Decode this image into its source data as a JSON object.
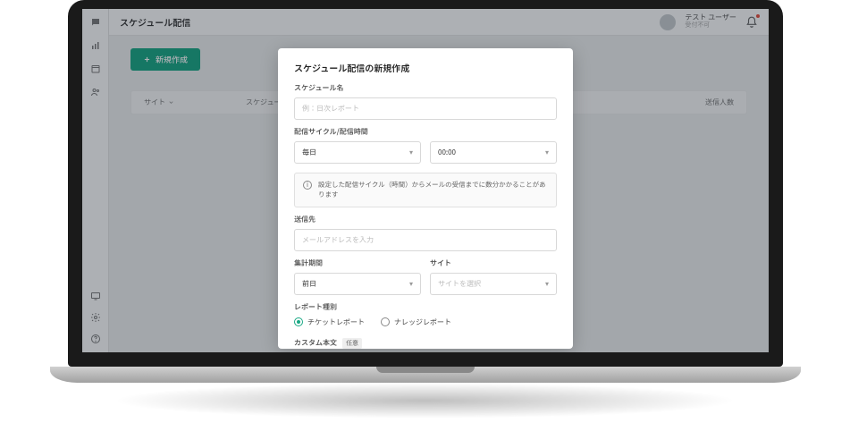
{
  "header": {
    "page_title": "スケジュール配信",
    "user_name": "テスト ユーザー",
    "user_status": "受付不可"
  },
  "content": {
    "new_button": "新規作成",
    "table": {
      "col_site": "サイト",
      "col_schedule": "スケジュー…",
      "col_recipients": "送信人数"
    }
  },
  "modal": {
    "title": "スケジュール配信の新規作成",
    "schedule_name_label": "スケジュール名",
    "schedule_name_placeholder": "例：日次レポート",
    "cycle_label": "配信サイクル/配信時間",
    "cycle_value": "毎日",
    "time_value": "00:00",
    "info_text": "設定した配信サイクル（時間）からメールの受信までに数分かかることがあります",
    "recipients_label": "送信先",
    "recipients_placeholder": "メールアドレスを入力",
    "period_label": "集計期間",
    "period_value": "前日",
    "site_label": "サイト",
    "site_placeholder": "サイトを選択",
    "report_type_label": "レポート種別",
    "report_ticket": "チケットレポート",
    "report_knowledge": "ナレッジレポート",
    "custom_body_label": "カスタム本文",
    "custom_body_badge": "任意"
  }
}
